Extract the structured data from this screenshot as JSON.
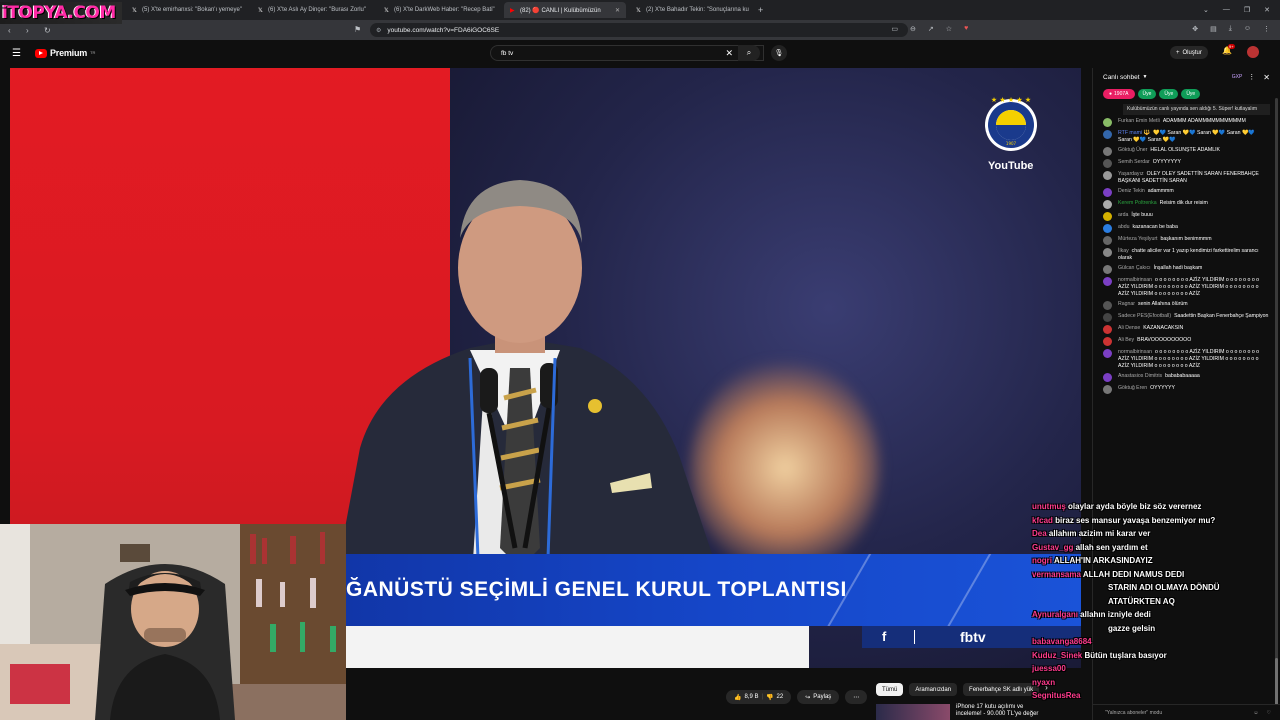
{
  "brand_overlay": "iTOPYA.COM",
  "browser": {
    "tabs": [
      {
        "label": "(5) X'te emirhanxsi: \"Bokan'ı yemeye\"",
        "icon": "x-icon",
        "active": false
      },
      {
        "label": "(6) X'te Aslı Ay Dinçer: \"Burası Zorlu\"",
        "icon": "x-icon",
        "active": false
      },
      {
        "label": "(6) X'te DarkWeb Haber: \"Recep Bati\"",
        "icon": "x-icon",
        "active": false
      },
      {
        "label": "(82) 🔴 CANLI | Kulübümüzün",
        "icon": "youtube-icon",
        "active": true
      },
      {
        "label": "(2) X'te Bahadır Tekin: \"Sonuçlarına ku",
        "icon": "x-icon",
        "active": false
      }
    ],
    "url": "youtube.com/watch?v=FDA6iGOC6SE"
  },
  "youtube": {
    "brand": "Premium",
    "brand_sup": "TR",
    "search_value": "fb tv",
    "create_label": "Oluştur",
    "notif_count": "9+"
  },
  "video": {
    "lower_third": "ĞANÜSTÜ SEÇİMLİ GENEL KURUL TOPLANTISI",
    "fb_tv": "fbtv",
    "watermark": "YouTube",
    "crest_year": "1907"
  },
  "below": {
    "likes": "8,9 B",
    "dislikes": "22",
    "share": "Paylaş",
    "chips": [
      "Tümü",
      "Aramanızdan",
      "Fenerbahçe SK adlı yük"
    ],
    "rec_title": "iPhone 17 kutu açılımı ve",
    "rec_subtitle": "inceleme! - 90.000 TL'ye değer"
  },
  "chat": {
    "title": "Canlı sohbet",
    "gxp": "GXP",
    "pinned_user": "1907A",
    "badges": [
      "Üye",
      "Üye",
      "Üye"
    ],
    "pinned_text": "Kulübümüzün canlı yayında sen aldığı 5. Süper! kutlayalım",
    "input_placeholder": "\"Yalnızca aboneler\" modu",
    "messages": [
      {
        "author": "Furkan Emin Metli",
        "text": "ADAMMM ADAMMMMMMMMMMM",
        "color": "#8b6",
        "cls": ""
      },
      {
        "author": "RTF mami 🔱",
        "text": "💛💙 Saran 💛💙 Saran 💛💙 Saran 💛💙 Saran 💛💙 Saran 💛💙",
        "color": "#36a",
        "cls": "mod"
      },
      {
        "author": "Göktuğ Üner",
        "text": "HELAL OLSUNŞTE ADAMLIK",
        "color": "#777",
        "cls": ""
      },
      {
        "author": "Semih Serdar",
        "text": "OYYYYYYY",
        "color": "#555",
        "cls": ""
      },
      {
        "author": "Yaşardayız",
        "text": "OLEY OLEY SADETTİN SARAN FENERBAHÇE BAŞKANI SADETTİN SARAN",
        "color": "#999",
        "cls": ""
      },
      {
        "author": "Deniz Tekin",
        "text": "adammmm",
        "color": "#7b3fc4",
        "cls": ""
      },
      {
        "author": "Kerem Poltrenka",
        "text": "Reisim dik dur reisim",
        "color": "#aaa",
        "cls": "grn"
      },
      {
        "author": "arda",
        "text": "İşte buuu",
        "color": "#d4b100",
        "cls": ""
      },
      {
        "author": "abdu",
        "text": "kazanacan be baba",
        "color": "#2a7de1",
        "cls": ""
      },
      {
        "author": "Mürteza Yeşilyurt",
        "text": "başkanım benimmmm",
        "color": "#666",
        "cls": ""
      },
      {
        "author": "İlkay",
        "text": "chatte aliciler var 1 yazıp kendimizi farkettirelim sarancı olarak",
        "color": "#888",
        "cls": ""
      },
      {
        "author": "Gülcan Çakıcı",
        "text": "İnşallah hadi başkam",
        "color": "#777",
        "cls": ""
      },
      {
        "author": "normalbirinsan",
        "text": "o o o o o o o o AZİZ YILDIRIM o o o o o o o o AZİZ YILDIRIM o o o o o o o o AZİZ YILDIRIM o o o o o o o o AZİZ YILDIRIM o o o o o o o o AZİZ",
        "color": "#7b3fc4",
        "cls": ""
      },
      {
        "author": "Ragnar",
        "text": "senin Allahına ölürüm",
        "color": "#555",
        "cls": ""
      },
      {
        "author": "Sadece PES(Efootball)",
        "text": "Saadettin Başkan Fenerbahçe Şampiyon",
        "color": "#444",
        "cls": ""
      },
      {
        "author": "Ali Dense",
        "text": "KAZANACAKSIN",
        "color": "#c33",
        "cls": ""
      },
      {
        "author": "Ali Bey",
        "text": "BRAVOOOOOOOOOO",
        "color": "#c33",
        "cls": ""
      },
      {
        "author": "normalbirinsan",
        "text": "o o o o o o o o AZİZ YILDIRIM o o o o o o o o AZİZ YILDIRIM o o o o o o o o AZİZ YILDIRIM o o o o o o o o AZİZ YILDIRIM o o o o o o o o AZİZ",
        "color": "#7b3fc4",
        "cls": ""
      },
      {
        "author": "Anastasios Dimitris",
        "text": "babababaaaaa",
        "color": "#7b3fc4",
        "cls": ""
      },
      {
        "author": "Göktuğ Eren",
        "text": "OYYYYYY",
        "color": "#777",
        "cls": ""
      }
    ],
    "overlay": [
      {
        "name": "unutmuş",
        "text": "olaylar ayda böyle biz söz verernez"
      },
      {
        "name": "kfcad",
        "text": "biraz ses mansur yavaşa benzemiyor mu?"
      },
      {
        "name": "Dea",
        "text": "allahım azizim mi karar ver"
      },
      {
        "name": "Gustav_gg",
        "text": "allah sen yardım et"
      },
      {
        "name": "nogri",
        "text": "ALLAH'IN ARKASINDAYIZ"
      },
      {
        "name": "vermansama",
        "text": "ALLAH DEDI NAMUS DEDI"
      },
      {
        "name": "",
        "text": "STARIN ADI OLMAYA DÖNDÜ"
      },
      {
        "name": "",
        "text": "ATATÜRKTEN AQ"
      },
      {
        "name": "Aynuralganı",
        "text": "allahın izniyle dedi"
      },
      {
        "name": "",
        "text": "gazze gelsin"
      },
      {
        "name": "babavanga8684",
        "text": ""
      },
      {
        "name": "Kuduz_Sinek",
        "text": "Bütün tuşlara basıyor"
      },
      {
        "name": "juessa00",
        "text": ""
      },
      {
        "name": "nyaxn",
        "text": ""
      },
      {
        "name": "SegnitusRea",
        "text": ""
      }
    ]
  }
}
